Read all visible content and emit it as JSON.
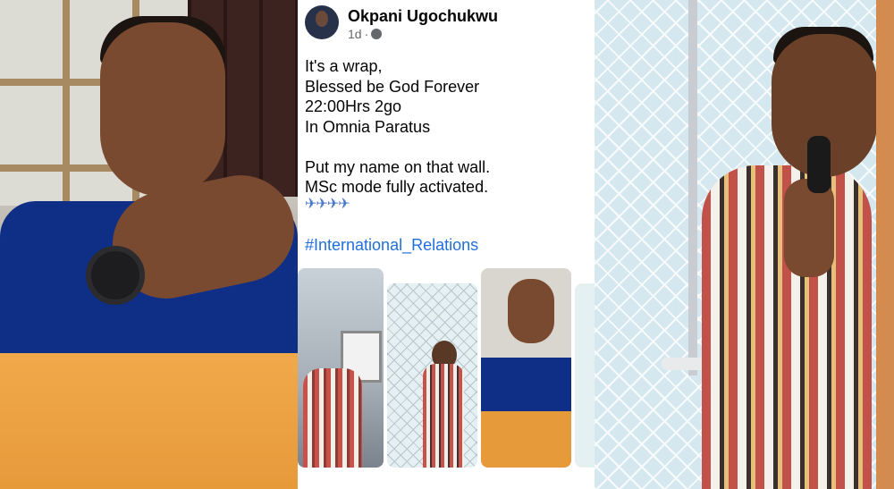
{
  "post": {
    "author": "Okpani Ugochukwu",
    "timestamp": "1d",
    "separator": "·",
    "lines": [
      "It's a wrap,",
      "Blessed be God Forever",
      "22:00Hrs 2go",
      "In Omnia Paratus",
      "",
      "Put my name on that wall.",
      "MSc mode fully activated."
    ],
    "emoji_row": "✈✈✈✈",
    "hashtag": "#International_Relations"
  },
  "colors": {
    "link": "#216fdb",
    "meta_grey": "#65676b",
    "shirt_blue": "#0f2f86",
    "pillow_orange": "#e79a3a"
  },
  "icons": {
    "audience": "globe-icon",
    "emoji": "airplane-icon"
  }
}
